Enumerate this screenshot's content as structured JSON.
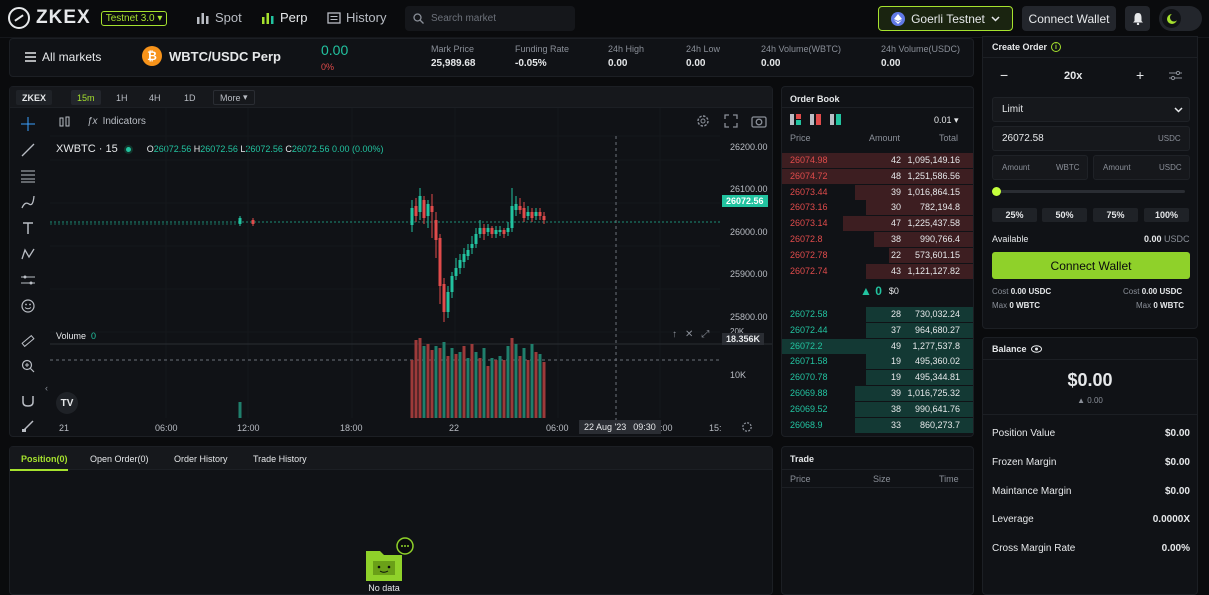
{
  "header": {
    "logo_text": "ZKEX",
    "testnet_label": "Testnet 3.0",
    "nav": [
      {
        "label": "Spot"
      },
      {
        "label": "Perp"
      },
      {
        "label": "History"
      }
    ],
    "search_placeholder": "Search market",
    "network_label": "Goerli Testnet",
    "connect_label": "Connect Wallet"
  },
  "market": {
    "all_markets": "All markets",
    "pair": "WBTC/USDC Perp",
    "last_price": "0.00",
    "change": "0%",
    "stats": [
      {
        "label": "Mark Price",
        "value": "25,989.68"
      },
      {
        "label": "Funding Rate",
        "value": "-0.05%"
      },
      {
        "label": "24h High",
        "value": "0.00"
      },
      {
        "label": "24h Low",
        "value": "0.00"
      },
      {
        "label": "24h Volume(WBTC)",
        "value": "0.00"
      },
      {
        "label": "24h Volume(USDC)",
        "value": "0.00"
      }
    ]
  },
  "chart": {
    "brand": "ZKEX",
    "timeframes": [
      "15m",
      "1H",
      "4H",
      "1D",
      "More"
    ],
    "active_timeframe": "15m",
    "indicators_label": "Indicators",
    "symbol": "XWBTC · 15",
    "ohlc": {
      "o": "26072.56",
      "h": "26072.56",
      "l": "26072.56",
      "c": "26072.56",
      "chg": "0.00 (0.00%)"
    },
    "current_price": "26072.56",
    "volume_label": "Volume",
    "volume_value": "0",
    "volume_marker": "18.356K",
    "volume_tick": "10K",
    "volume_tick_top": "20K",
    "price_ticks": [
      "26200.00",
      "26100.00",
      "26000.00",
      "25900.00",
      "25800.00"
    ],
    "time_ticks": [
      "21",
      "06:00",
      "12:00",
      "18:00",
      "22",
      "06:00",
      ":00",
      "15:"
    ],
    "crosshair_date": "22 Aug '23",
    "crosshair_time": "09:30"
  },
  "orderbook": {
    "title": "Order Book",
    "precision": "0.01",
    "col_price": "Price",
    "col_amount": "Amount",
    "col_total": "Total",
    "asks": [
      {
        "price": "26074.98",
        "amount": "42",
        "total": "1,095,149.16",
        "depth": 1.0
      },
      {
        "price": "26074.72",
        "amount": "48",
        "total": "1,251,586.56",
        "depth": 1.0
      },
      {
        "price": "26073.44",
        "amount": "39",
        "total": "1,016,864.15",
        "depth": 0.62
      },
      {
        "price": "26073.16",
        "amount": "30",
        "total": "782,194.8",
        "depth": 0.56
      },
      {
        "price": "26073.14",
        "amount": "47",
        "total": "1,225,437.58",
        "depth": 0.68
      },
      {
        "price": "26072.8",
        "amount": "38",
        "total": "990,766.4",
        "depth": 0.52
      },
      {
        "price": "26072.78",
        "amount": "22",
        "total": "573,601.15",
        "depth": 0.44
      },
      {
        "price": "26072.74",
        "amount": "43",
        "total": "1,121,127.82",
        "depth": 0.56
      }
    ],
    "mid_price": "0",
    "mid_usd": "$0",
    "bids": [
      {
        "price": "26072.58",
        "amount": "28",
        "total": "730,032.24",
        "depth": 0.56
      },
      {
        "price": "26072.44",
        "amount": "37",
        "total": "964,680.27",
        "depth": 0.56
      },
      {
        "price": "26072.2",
        "amount": "49",
        "total": "1,277,537.8",
        "depth": 1.0
      },
      {
        "price": "26071.58",
        "amount": "19",
        "total": "495,360.02",
        "depth": 0.56
      },
      {
        "price": "26070.78",
        "amount": "19",
        "total": "495,344.81",
        "depth": 0.56
      },
      {
        "price": "26069.88",
        "amount": "39",
        "total": "1,016,725.32",
        "depth": 0.62
      },
      {
        "price": "26069.52",
        "amount": "38",
        "total": "990,641.76",
        "depth": 0.62
      },
      {
        "price": "26068.9",
        "amount": "33",
        "total": "860,273.7",
        "depth": 0.62
      }
    ]
  },
  "order_form": {
    "title": "Create Order",
    "leverage": "20x",
    "order_type": "Limit",
    "price_value": "26072.58",
    "price_unit": "USDC",
    "amount_placeholder": "Amount",
    "unit_base": "WBTC",
    "unit_quote": "USDC",
    "pcts": [
      "25%",
      "50%",
      "75%",
      "100%"
    ],
    "available_label": "Available",
    "available_value": "0.00",
    "available_unit": "USDC",
    "connect_label": "Connect Wallet",
    "cost_label": "Cost",
    "cost_value": "0.00 USDC",
    "max_label": "Max",
    "max_value": "0 WBTC"
  },
  "balance": {
    "title": "Balance",
    "amount": "$0.00",
    "sub": "▲ 0.00",
    "rows": [
      {
        "label": "Position Value",
        "value": "$0.00"
      },
      {
        "label": "Frozen Margin",
        "value": "$0.00"
      },
      {
        "label": "Maintance Margin",
        "value": "$0.00"
      },
      {
        "label": "Leverage",
        "value": "0.0000X"
      },
      {
        "label": "Cross Margin Rate",
        "value": "0.00%"
      }
    ]
  },
  "positions": {
    "tabs": [
      "Position(0)",
      "Open Order(0)",
      "Order History",
      "Trade History"
    ],
    "empty_label": "No data"
  },
  "trade": {
    "title": "Trade",
    "col_price": "Price",
    "col_size": "Size",
    "col_time": "Time"
  },
  "colors": {
    "accent": "#a6e22e",
    "up": "#22c3a0",
    "down": "#e04b4b",
    "bg": "#0a0b0d",
    "panel": "#101216"
  }
}
